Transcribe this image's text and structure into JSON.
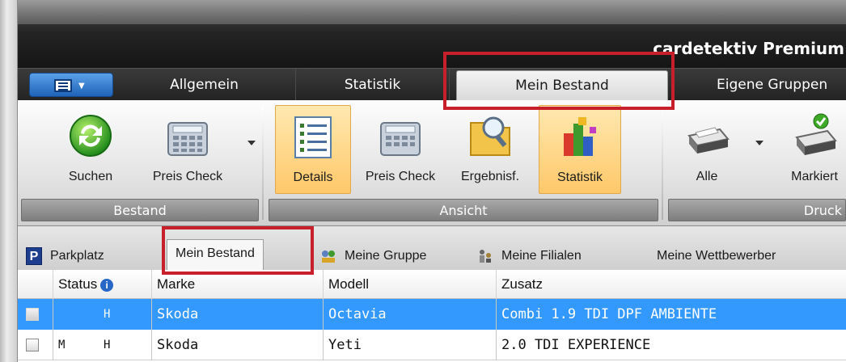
{
  "app": {
    "title": "cardetektiv Premium"
  },
  "ribbon_tabs": [
    {
      "label": "Allgemein",
      "active": false
    },
    {
      "label": "Statistik",
      "active": false
    },
    {
      "label": "Mein Bestand",
      "active": true
    },
    {
      "label": "Eigene Gruppen",
      "active": false
    }
  ],
  "ribbon_groups": {
    "bestand": {
      "label": "Bestand",
      "buttons": [
        {
          "label": "Suchen",
          "icon": "refresh-icon"
        },
        {
          "label": "Preis Check",
          "icon": "calculator-icon"
        }
      ]
    },
    "ansicht": {
      "label": "Ansicht",
      "buttons": [
        {
          "label": "Details",
          "icon": "list-icon",
          "highlighted": true
        },
        {
          "label": "Preis Check",
          "icon": "calculator-icon"
        },
        {
          "label": "Ergebnisf.",
          "icon": "folder-search-icon"
        },
        {
          "label": "Statistik",
          "icon": "chart-cube-icon",
          "highlighted": true
        }
      ]
    },
    "druck": {
      "label": "Druck",
      "buttons": [
        {
          "label": "Alle",
          "icon": "printer-icon"
        },
        {
          "label": "Markiert",
          "icon": "printer-check-icon"
        }
      ]
    }
  },
  "doc_tabs": [
    {
      "label": "Parkplatz",
      "icon": "parking-icon",
      "active": false
    },
    {
      "label": "Mein Bestand",
      "icon": "",
      "active": true
    },
    {
      "label": "Meine Gruppe",
      "icon": "group-icon",
      "active": false
    },
    {
      "label": "Meine Filialen",
      "icon": "branch-icon",
      "active": false
    },
    {
      "label": "Meine Wettbewerber",
      "icon": "",
      "active": false
    }
  ],
  "table": {
    "columns": [
      "Status",
      "Marke",
      "Modell",
      "Zusatz"
    ],
    "rows": [
      {
        "status1": "",
        "status2": "H",
        "marke": "Skoda",
        "modell": "Octavia",
        "zusatz": "Combi 1.9 TDI DPF AMBIENTE",
        "selected": true
      },
      {
        "status1": "M",
        "status2": "H",
        "marke": "Skoda",
        "modell": "Yeti",
        "zusatz": "2.0 TDI EXPERIENCE",
        "selected": false
      }
    ]
  },
  "colors": {
    "selection": "#3399ff",
    "highlight_box": "#c8202a",
    "ribbon_highlight": "#ffc86a"
  }
}
